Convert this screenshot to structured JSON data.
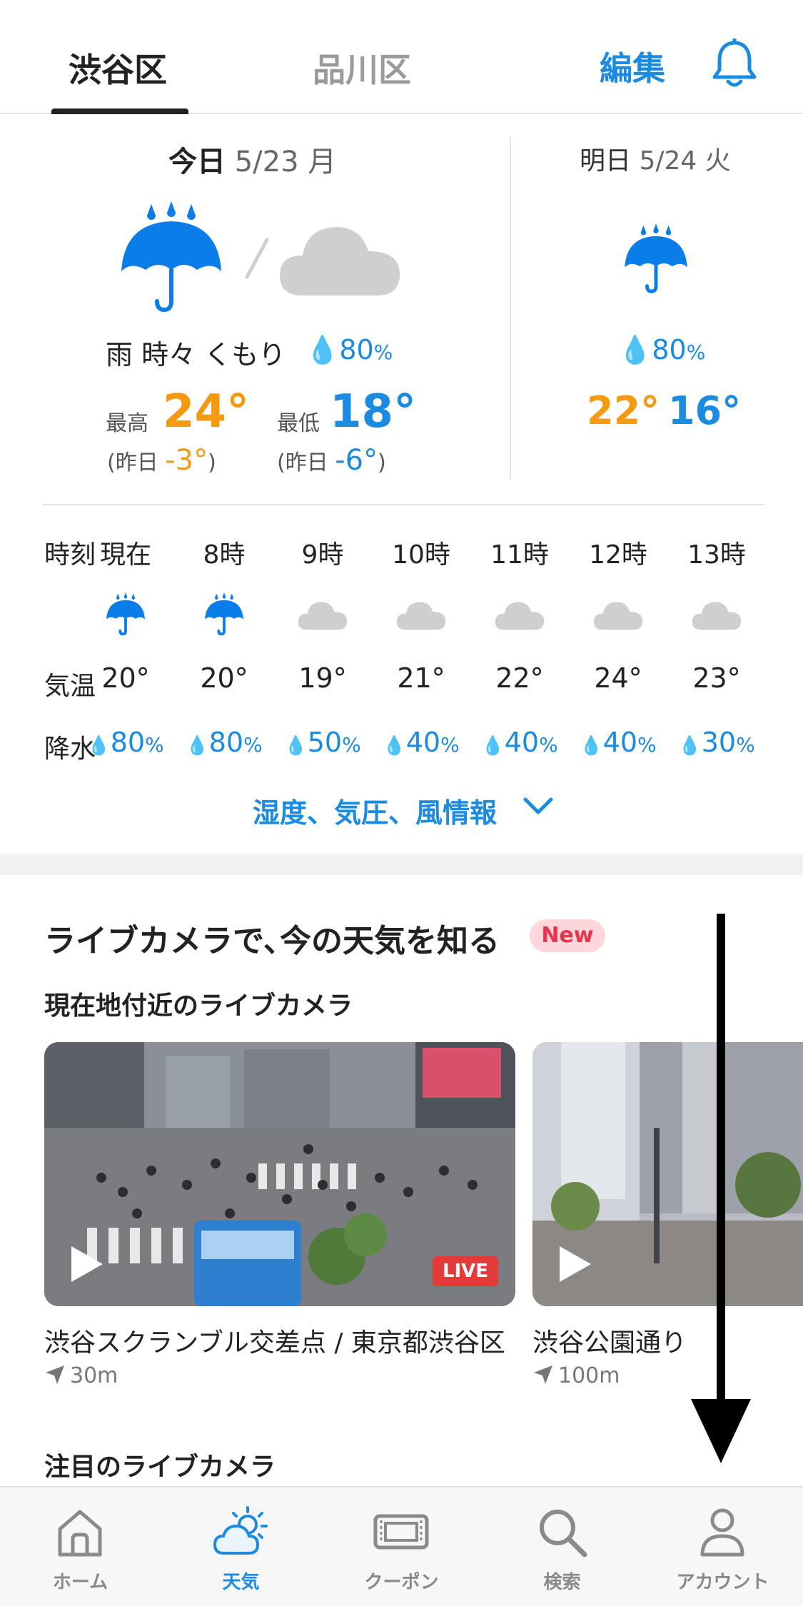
{
  "top_tabs": [
    {
      "label": "渋谷区",
      "active": true
    },
    {
      "label": "品川区",
      "active": false
    }
  ],
  "edit_label": "編集",
  "today": {
    "label": "今日",
    "date": "5/23 月",
    "condition": "雨 時々 くもり",
    "precip": "80",
    "high_label": "最高",
    "high": "24°",
    "low_label": "最低",
    "low": "18°",
    "high_diff_prefix": "(昨日 ",
    "high_diff": "-3°",
    "low_diff": "-6°",
    "diff_suffix": ")",
    "icons": [
      "umbrella-rain-icon",
      "cloud-icon"
    ]
  },
  "tomorrow": {
    "label": "明日",
    "date": "5/24 火",
    "precip": "80",
    "high": "22°",
    "low": "16°",
    "icon": "umbrella-rain-icon"
  },
  "percent_sign": "%",
  "hourly": {
    "time_label": "時刻",
    "temp_label": "気温",
    "precip_label": "降水",
    "hours": [
      {
        "time": "現在",
        "icon": "umbrella-rain-icon",
        "temp": "20°",
        "precip": "80"
      },
      {
        "time": "8時",
        "icon": "umbrella-rain-icon",
        "temp": "20°",
        "precip": "80"
      },
      {
        "time": "9時",
        "icon": "cloud-icon",
        "temp": "19°",
        "precip": "50"
      },
      {
        "time": "10時",
        "icon": "cloud-icon",
        "temp": "21°",
        "precip": "40"
      },
      {
        "time": "11時",
        "icon": "cloud-icon",
        "temp": "22°",
        "precip": "40"
      },
      {
        "time": "12時",
        "icon": "cloud-icon",
        "temp": "24°",
        "precip": "40"
      },
      {
        "time": "13時",
        "icon": "cloud-icon",
        "temp": "23°",
        "precip": "30"
      }
    ],
    "more_link": "湿度、気圧、風情報"
  },
  "live_camera": {
    "title": "ライブカメラで､今の天気を知る",
    "badge": "New",
    "nearby_title": "現在地付近のライブカメラ",
    "cameras": [
      {
        "name": "渋谷スクランブル交差点 / 東京都渋谷区",
        "distance": "30m",
        "live_label": "LIVE"
      },
      {
        "name": "渋谷公園通り",
        "distance": "100m"
      }
    ],
    "featured_title": "注目のライブカメラ"
  },
  "bottom_nav": [
    {
      "label": "ホーム",
      "icon": "home-icon",
      "active": false
    },
    {
      "label": "天気",
      "icon": "weather-icon",
      "active": true
    },
    {
      "label": "クーポン",
      "icon": "coupon-icon",
      "active": false
    },
    {
      "label": "検索",
      "icon": "search-icon",
      "active": false
    },
    {
      "label": "アカウント",
      "icon": "account-icon",
      "active": false
    }
  ],
  "colors": {
    "accent_blue": "#1a8be0",
    "high_orange": "#f59a10",
    "new_badge_bg": "#ffd6dc",
    "live_red": "#e43a3a"
  }
}
